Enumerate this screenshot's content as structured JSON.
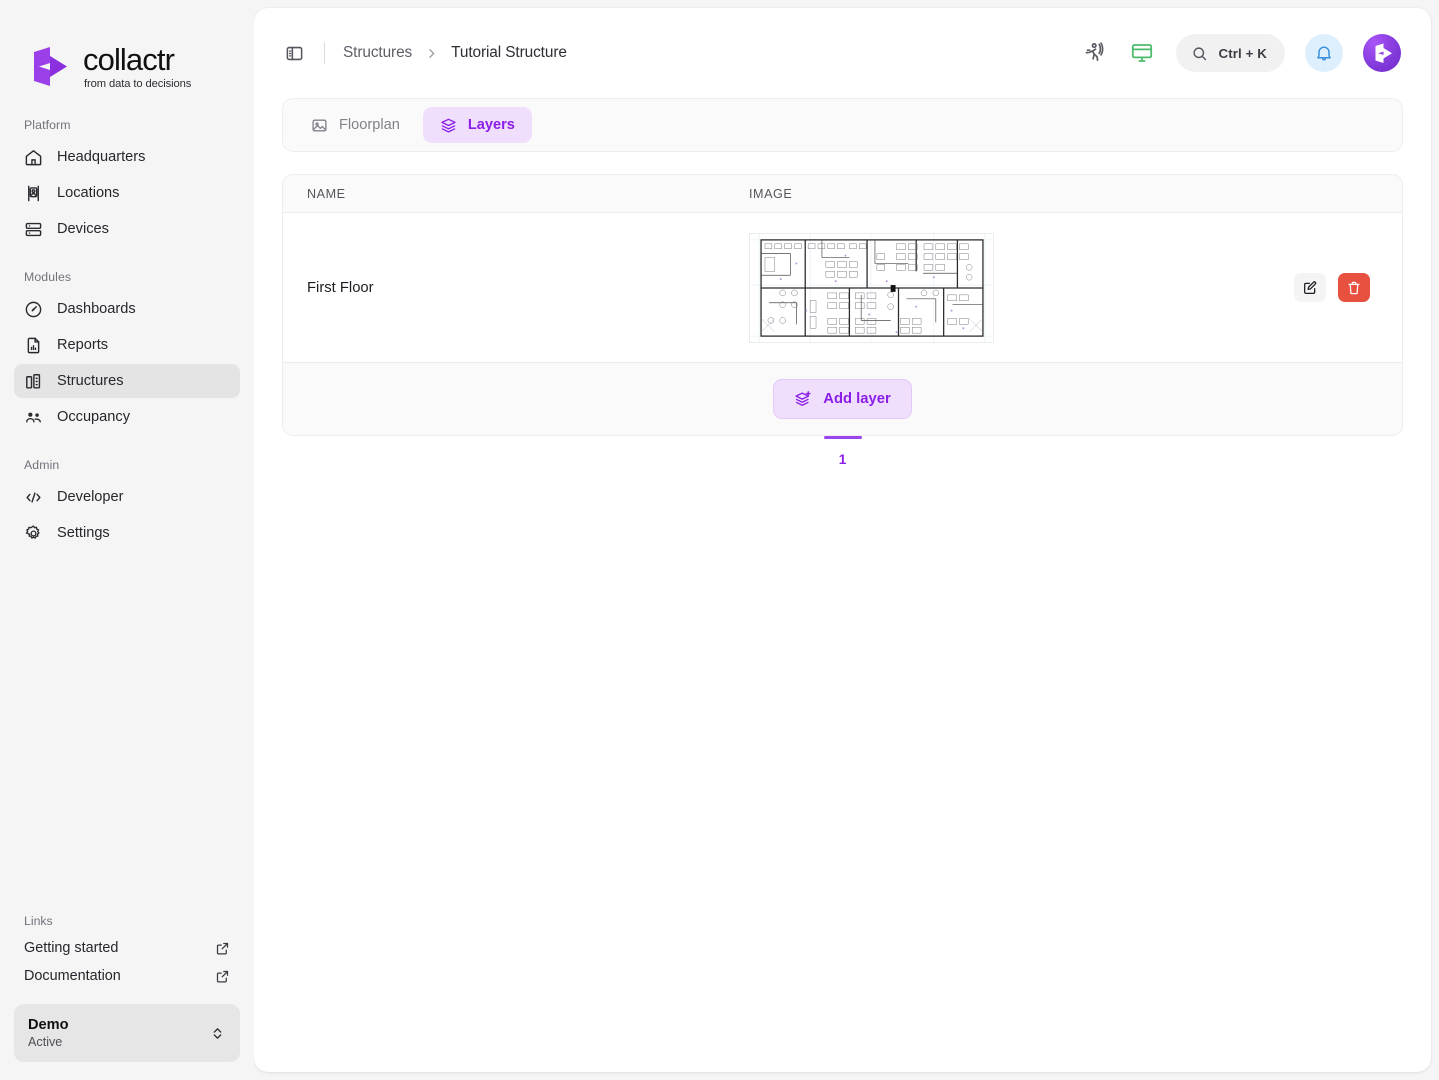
{
  "brand": {
    "name": "collactr",
    "tagline": "from data to decisions",
    "logo_icon": "collactr-logo-mark",
    "accent_purple": "#8b1ee8",
    "accent_purple_light": "#f0dffc",
    "danger_red": "#e8503f",
    "bell_blue": "#3b8fdc",
    "monitor_green": "#4cbb6b"
  },
  "sidebar": {
    "groups": [
      {
        "label": "Platform",
        "items": [
          {
            "label": "Headquarters",
            "icon": "home-icon",
            "active": false
          },
          {
            "label": "Locations",
            "icon": "map-pin-user-icon",
            "active": false
          },
          {
            "label": "Devices",
            "icon": "server-stack-icon",
            "active": false
          }
        ]
      },
      {
        "label": "Modules",
        "items": [
          {
            "label": "Dashboards",
            "icon": "gauge-icon",
            "active": false
          },
          {
            "label": "Reports",
            "icon": "file-chart-icon",
            "active": false
          },
          {
            "label": "Structures",
            "icon": "building-icon",
            "active": true
          },
          {
            "label": "Occupancy",
            "icon": "users-group-icon",
            "active": false
          }
        ]
      },
      {
        "label": "Admin",
        "items": [
          {
            "label": "Developer",
            "icon": "code-brackets-icon",
            "active": false
          },
          {
            "label": "Settings",
            "icon": "gear-icon",
            "active": false
          }
        ]
      }
    ],
    "links_label": "Links",
    "links": [
      {
        "label": "Getting started",
        "icon": "external-link-icon"
      },
      {
        "label": "Documentation",
        "icon": "external-link-icon"
      }
    ],
    "workspace": {
      "name": "Demo",
      "status": "Active",
      "icon": "chevron-up-down-icon"
    }
  },
  "header": {
    "panel_toggle_icon": "sidebar-panel-icon",
    "breadcrumbs": [
      {
        "label": "Structures",
        "current": false
      },
      {
        "label": "Tutorial Structure",
        "current": true
      }
    ],
    "separator_icon": "chevron-right-icon",
    "actions": {
      "activity_icon": "running-person-icon",
      "display_icon": "monitor-icon",
      "search": {
        "icon": "search-icon",
        "shortcut": "Ctrl + K"
      },
      "notifications_icon": "bell-icon",
      "avatar_icon": "collactr-logo-mark"
    }
  },
  "tabs": [
    {
      "label": "Floorplan",
      "icon": "image-icon",
      "active": false
    },
    {
      "label": "Layers",
      "icon": "layers-icon",
      "active": true
    }
  ],
  "table": {
    "columns": [
      {
        "key": "name",
        "label": "NAME"
      },
      {
        "key": "image",
        "label": "IMAGE"
      }
    ],
    "rows": [
      {
        "name": "First Floor",
        "image_alt": "architectural-floorplan-thumbnail",
        "actions": [
          {
            "name": "edit",
            "icon": "edit-pencil-square-icon"
          },
          {
            "name": "delete",
            "icon": "trash-icon"
          }
        ]
      }
    ],
    "add_button": {
      "label": "Add layer",
      "icon": "layers-plus-icon"
    }
  },
  "pagination": {
    "pages": [
      "1"
    ],
    "current": "1"
  }
}
